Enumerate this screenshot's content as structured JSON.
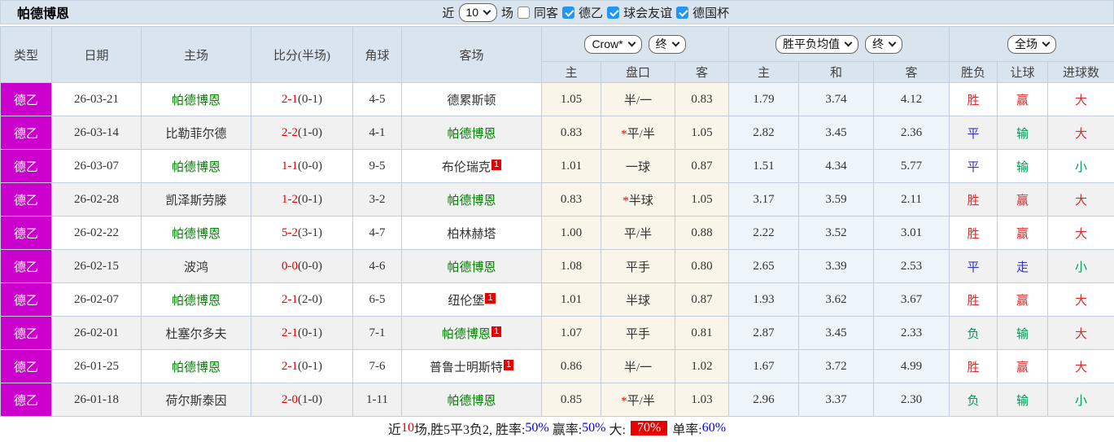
{
  "title": "帕德博恩",
  "filterbar": {
    "near_label": "近",
    "count_select": "10",
    "games_label": "场",
    "checkboxes": [
      {
        "label": "同客",
        "checked": false
      },
      {
        "label": "德乙",
        "checked": true
      },
      {
        "label": "球会友谊",
        "checked": true
      },
      {
        "label": "德国杯",
        "checked": true
      }
    ]
  },
  "header": {
    "static_columns": [
      "类型",
      "日期",
      "主场",
      "比分(半场)",
      "角球",
      "客场"
    ],
    "odds_group": {
      "bookmaker_select": "Crow*",
      "time_select": "终",
      "subcolumns": [
        "主",
        "盘口",
        "客"
      ]
    },
    "mean_group": {
      "metric_select": "胜平负均值",
      "time_select": "终",
      "subcolumns": [
        "主",
        "和",
        "客"
      ]
    },
    "result_group": {
      "scope_select": "全场",
      "subcolumns": [
        "胜负",
        "让球",
        "进球数"
      ]
    }
  },
  "colors": {
    "league_bg": "#cc00cc",
    "score_red": "#e60000",
    "team_green": "#008000",
    "result_red": "#dd2c2c",
    "result_blue": "#3333cc",
    "result_green": "#009955",
    "percent_blue": "#0000ee",
    "hot_bg": "#e60000",
    "odds_bg": "#faf5e9",
    "mean_bg": "#edf4fa"
  },
  "rows": [
    {
      "league": "德乙",
      "date": "26-03-21",
      "home": {
        "name": "帕德博恩",
        "green": true,
        "badge": ""
      },
      "score_ft": "2-1",
      "score_ht": "(0-1)",
      "corners": "4-5",
      "away": {
        "name": "德累斯顿",
        "green": false,
        "badge": ""
      },
      "odds": {
        "home": "1.05",
        "star": false,
        "handicap": "半/一",
        "away": "0.83"
      },
      "mean": {
        "home": "1.79",
        "draw": "3.74",
        "away": "4.12"
      },
      "results": {
        "wdl": {
          "text": "胜",
          "color": "red"
        },
        "handicap": {
          "text": "赢",
          "color": "red"
        },
        "goals": {
          "text": "大",
          "color": "red"
        }
      }
    },
    {
      "league": "德乙",
      "date": "26-03-14",
      "home": {
        "name": "比勒菲尔德",
        "green": false,
        "badge": ""
      },
      "score_ft": "2-2",
      "score_ht": "(1-0)",
      "corners": "4-1",
      "away": {
        "name": "帕德博恩",
        "green": true,
        "badge": ""
      },
      "odds": {
        "home": "0.83",
        "star": true,
        "handicap": "平/半",
        "away": "1.05"
      },
      "mean": {
        "home": "2.82",
        "draw": "3.45",
        "away": "2.36"
      },
      "results": {
        "wdl": {
          "text": "平",
          "color": "blue"
        },
        "handicap": {
          "text": "输",
          "color": "green"
        },
        "goals": {
          "text": "大",
          "color": "red"
        }
      }
    },
    {
      "league": "德乙",
      "date": "26-03-07",
      "home": {
        "name": "帕德博恩",
        "green": true,
        "badge": ""
      },
      "score_ft": "1-1",
      "score_ht": "(0-0)",
      "corners": "9-5",
      "away": {
        "name": "布伦瑞克",
        "green": false,
        "badge": "1"
      },
      "odds": {
        "home": "1.01",
        "star": false,
        "handicap": "一球",
        "away": "0.87"
      },
      "mean": {
        "home": "1.51",
        "draw": "4.34",
        "away": "5.77"
      },
      "results": {
        "wdl": {
          "text": "平",
          "color": "blue"
        },
        "handicap": {
          "text": "输",
          "color": "green"
        },
        "goals": {
          "text": "小",
          "color": "green"
        }
      }
    },
    {
      "league": "德乙",
      "date": "26-02-28",
      "home": {
        "name": "凯泽斯劳滕",
        "green": false,
        "badge": ""
      },
      "score_ft": "1-2",
      "score_ht": "(0-1)",
      "corners": "3-2",
      "away": {
        "name": "帕德博恩",
        "green": true,
        "badge": ""
      },
      "odds": {
        "home": "0.83",
        "star": true,
        "handicap": "半球",
        "away": "1.05"
      },
      "mean": {
        "home": "3.17",
        "draw": "3.59",
        "away": "2.11"
      },
      "results": {
        "wdl": {
          "text": "胜",
          "color": "red"
        },
        "handicap": {
          "text": "赢",
          "color": "red"
        },
        "goals": {
          "text": "大",
          "color": "red"
        }
      }
    },
    {
      "league": "德乙",
      "date": "26-02-22",
      "home": {
        "name": "帕德博恩",
        "green": true,
        "badge": ""
      },
      "score_ft": "5-2",
      "score_ht": "(3-1)",
      "corners": "4-7",
      "away": {
        "name": "柏林赫塔",
        "green": false,
        "badge": ""
      },
      "odds": {
        "home": "1.00",
        "star": false,
        "handicap": "平/半",
        "away": "0.88"
      },
      "mean": {
        "home": "2.22",
        "draw": "3.52",
        "away": "3.01"
      },
      "results": {
        "wdl": {
          "text": "胜",
          "color": "red"
        },
        "handicap": {
          "text": "赢",
          "color": "red"
        },
        "goals": {
          "text": "大",
          "color": "red"
        }
      }
    },
    {
      "league": "德乙",
      "date": "26-02-15",
      "home": {
        "name": "波鸿",
        "green": false,
        "badge": ""
      },
      "score_ft": "0-0",
      "score_ht": "(0-0)",
      "corners": "4-6",
      "away": {
        "name": "帕德博恩",
        "green": true,
        "badge": ""
      },
      "odds": {
        "home": "1.08",
        "star": false,
        "handicap": "平手",
        "away": "0.80"
      },
      "mean": {
        "home": "2.65",
        "draw": "3.39",
        "away": "2.53"
      },
      "results": {
        "wdl": {
          "text": "平",
          "color": "blue"
        },
        "handicap": {
          "text": "走",
          "color": "blue"
        },
        "goals": {
          "text": "小",
          "color": "green"
        }
      }
    },
    {
      "league": "德乙",
      "date": "26-02-07",
      "home": {
        "name": "帕德博恩",
        "green": true,
        "badge": ""
      },
      "score_ft": "2-1",
      "score_ht": "(2-0)",
      "corners": "6-5",
      "away": {
        "name": "纽伦堡",
        "green": false,
        "badge": "1"
      },
      "odds": {
        "home": "1.01",
        "star": false,
        "handicap": "半球",
        "away": "0.87"
      },
      "mean": {
        "home": "1.93",
        "draw": "3.62",
        "away": "3.67"
      },
      "results": {
        "wdl": {
          "text": "胜",
          "color": "red"
        },
        "handicap": {
          "text": "赢",
          "color": "red"
        },
        "goals": {
          "text": "大",
          "color": "red"
        }
      }
    },
    {
      "league": "德乙",
      "date": "26-02-01",
      "home": {
        "name": "杜塞尔多夫",
        "green": false,
        "badge": ""
      },
      "score_ft": "2-1",
      "score_ht": "(0-1)",
      "corners": "7-1",
      "away": {
        "name": "帕德博恩",
        "green": true,
        "badge": "1"
      },
      "odds": {
        "home": "1.07",
        "star": false,
        "handicap": "平手",
        "away": "0.81"
      },
      "mean": {
        "home": "2.87",
        "draw": "3.45",
        "away": "2.33"
      },
      "results": {
        "wdl": {
          "text": "负",
          "color": "green"
        },
        "handicap": {
          "text": "输",
          "color": "green"
        },
        "goals": {
          "text": "大",
          "color": "red"
        }
      }
    },
    {
      "league": "德乙",
      "date": "26-01-25",
      "home": {
        "name": "帕德博恩",
        "green": true,
        "badge": ""
      },
      "score_ft": "2-1",
      "score_ht": "(0-1)",
      "corners": "7-6",
      "away": {
        "name": "普鲁士明斯特",
        "green": false,
        "badge": "1"
      },
      "odds": {
        "home": "0.86",
        "star": false,
        "handicap": "半/一",
        "away": "1.02"
      },
      "mean": {
        "home": "1.67",
        "draw": "3.72",
        "away": "4.99"
      },
      "results": {
        "wdl": {
          "text": "胜",
          "color": "red"
        },
        "handicap": {
          "text": "赢",
          "color": "red"
        },
        "goals": {
          "text": "大",
          "color": "red"
        }
      }
    },
    {
      "league": "德乙",
      "date": "26-01-18",
      "home": {
        "name": "荷尔斯泰因",
        "green": false,
        "badge": ""
      },
      "score_ft": "2-0",
      "score_ht": "(1-0)",
      "corners": "1-11",
      "away": {
        "name": "帕德博恩",
        "green": true,
        "badge": ""
      },
      "odds": {
        "home": "0.85",
        "star": true,
        "handicap": "平/半",
        "away": "1.03"
      },
      "mean": {
        "home": "2.96",
        "draw": "3.37",
        "away": "2.30"
      },
      "results": {
        "wdl": {
          "text": "负",
          "color": "green"
        },
        "handicap": {
          "text": "输",
          "color": "green"
        },
        "goals": {
          "text": "小",
          "color": "green"
        }
      }
    }
  ],
  "summary": {
    "parts": [
      {
        "text": "近",
        "style": "plain"
      },
      {
        "text": "10",
        "style": "red"
      },
      {
        "text": "场,胜5平3负2, 胜率:",
        "style": "plain"
      },
      {
        "text": "50%",
        "style": "blue"
      },
      {
        "text": " 赢率:",
        "style": "plain"
      },
      {
        "text": "50%",
        "style": "blue"
      },
      {
        "text": " 大: ",
        "style": "plain"
      },
      {
        "text": "70%",
        "style": "hot"
      },
      {
        "text": " 单率:",
        "style": "plain"
      },
      {
        "text": "60%",
        "style": "blue"
      }
    ]
  }
}
